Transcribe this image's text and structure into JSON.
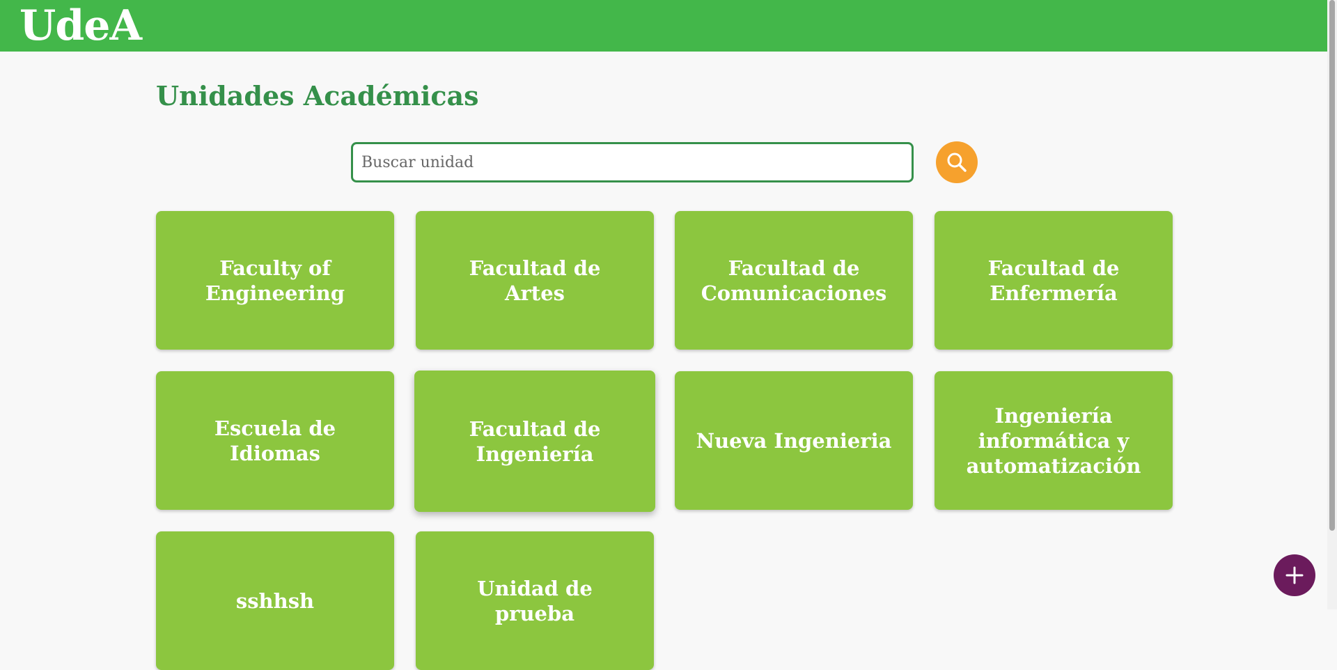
{
  "header": {
    "logo_text": "UdeA",
    "background_color": "#43b74a"
  },
  "main": {
    "title": "Unidades Académicas",
    "search": {
      "placeholder": "Buscar unidad",
      "value": "",
      "button_icon": "search-icon"
    },
    "units": [
      {
        "label": "Faculty of Engineering"
      },
      {
        "label": "Facultad de Artes"
      },
      {
        "label": "Facultad de Comunicaciones"
      },
      {
        "label": "Facultad de Enfermería"
      },
      {
        "label": "Escuela de Idiomas"
      },
      {
        "label": "Facultad de Ingeniería"
      },
      {
        "label": "Nueva Ingenieria"
      },
      {
        "label": "Ingeniería informática y automatización"
      },
      {
        "label": "sshhsh"
      },
      {
        "label": "Unidad de prueba"
      }
    ]
  },
  "fab": {
    "icon": "plus-icon",
    "color": "#6b1b5c"
  },
  "colors": {
    "accent_green": "#35904a",
    "card_green": "#8cc63f",
    "search_orange": "#f6a12d"
  }
}
